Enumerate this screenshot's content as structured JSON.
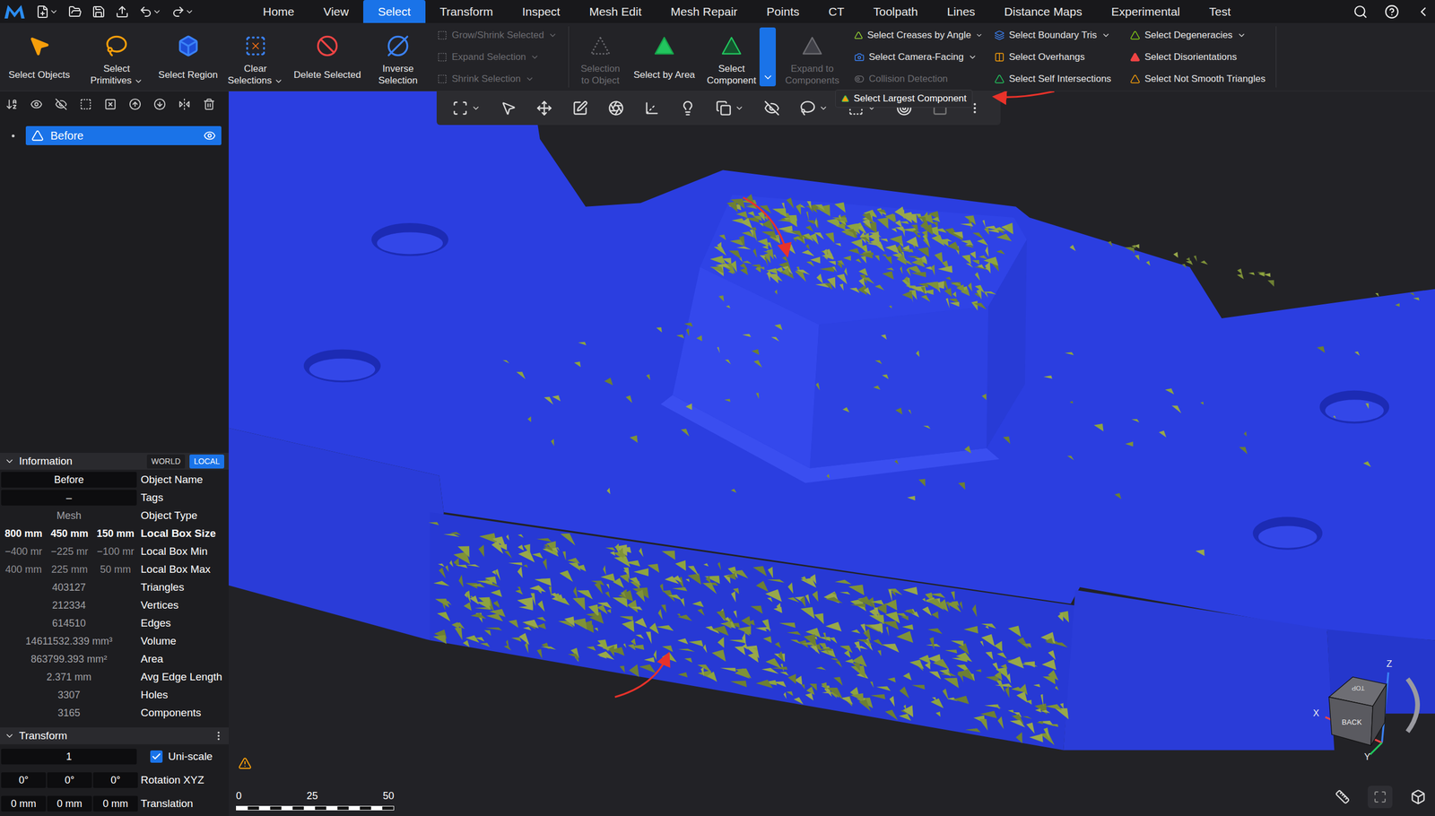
{
  "menubar": {
    "tabs": [
      {
        "label": "Home",
        "selected": false
      },
      {
        "label": "View",
        "selected": false
      },
      {
        "label": "Select",
        "selected": true
      },
      {
        "label": "Transform",
        "selected": false
      },
      {
        "label": "Inspect",
        "selected": false
      },
      {
        "label": "Mesh Edit",
        "selected": false
      },
      {
        "label": "Mesh Repair",
        "selected": false
      },
      {
        "label": "Points",
        "selected": false
      },
      {
        "label": "CT",
        "selected": false
      },
      {
        "label": "Toolpath",
        "selected": false
      },
      {
        "label": "Lines",
        "selected": false
      },
      {
        "label": "Distance Maps",
        "selected": false
      },
      {
        "label": "Experimental",
        "selected": false
      },
      {
        "label": "Test",
        "selected": false
      }
    ]
  },
  "ribbon": {
    "sections": [
      {
        "groups": [
          {
            "kind": "large",
            "label": "Select Objects",
            "disabled": false,
            "has_menu": false,
            "dropdown_open": false
          },
          {
            "kind": "large",
            "label": "Select Primitives",
            "disabled": false,
            "has_menu": true,
            "dropdown_open": false
          },
          {
            "kind": "large",
            "label": "Select Region",
            "disabled": false,
            "has_menu": false,
            "dropdown_open": false
          },
          {
            "kind": "large",
            "label": "Clear Selections",
            "disabled": false,
            "has_menu": true,
            "dropdown_open": false
          },
          {
            "kind": "large",
            "label": "Delete Selected",
            "disabled": false,
            "has_menu": false,
            "dropdown_open": false
          },
          {
            "kind": "large",
            "label": "Inverse Selection",
            "disabled": false,
            "has_menu": false,
            "dropdown_open": false
          },
          {
            "kind": "column",
            "items": [
              {
                "label": "Grow/Shrink Selected",
                "disabled": true,
                "has_menu": true
              },
              {
                "label": "Expand Selection",
                "disabled": true,
                "has_menu": true
              },
              {
                "label": "Shrink Selection",
                "disabled": true,
                "has_menu": true
              }
            ]
          }
        ]
      },
      {
        "groups": [
          {
            "kind": "large",
            "label": "Selection to Object",
            "disabled": true,
            "has_menu": false,
            "dropdown_open": false
          },
          {
            "kind": "large",
            "label": "Select by Area",
            "disabled": false,
            "has_menu": false,
            "dropdown_open": false
          },
          {
            "kind": "large",
            "label": "Select Component",
            "disabled": false,
            "has_menu": false,
            "dropdown_open": true
          },
          {
            "kind": "large",
            "label": "Expand to Components",
            "disabled": true,
            "has_menu": false,
            "dropdown_open": false
          },
          {
            "kind": "column",
            "items": [
              {
                "label": "Select Creases by Angle",
                "disabled": false,
                "has_menu": true
              },
              {
                "label": "Select Camera-Facing",
                "disabled": false,
                "has_menu": true
              },
              {
                "label": "Collision Detection",
                "disabled": true,
                "has_menu": false
              }
            ]
          },
          {
            "kind": "column",
            "items": [
              {
                "label": "Select Boundary Tris",
                "disabled": false,
                "has_menu": true
              },
              {
                "label": "Select Overhangs",
                "disabled": false,
                "has_menu": false
              },
              {
                "label": "Select Self Intersections",
                "disabled": false,
                "has_menu": false
              }
            ]
          },
          {
            "kind": "column",
            "items": [
              {
                "label": "Select Degeneracies",
                "disabled": false,
                "has_menu": true
              },
              {
                "label": "Select Disorientations",
                "disabled": false,
                "has_menu": false
              },
              {
                "label": "Select Not Smooth Triangles",
                "disabled": false,
                "has_menu": false
              }
            ]
          }
        ]
      }
    ]
  },
  "dropdown": {
    "items": [
      {
        "label": "Select Largest Component"
      }
    ]
  },
  "scene_tree": {
    "items": [
      {
        "label": "Before",
        "selected": true,
        "visible": true
      }
    ]
  },
  "information": {
    "title": "Information",
    "expanded": true,
    "frames": [
      {
        "label": "WORLD",
        "selected": false
      },
      {
        "label": "LOCAL",
        "selected": true
      }
    ],
    "rows": [
      {
        "kind": "field",
        "values": [
          "Before"
        ],
        "label": "Object Name"
      },
      {
        "kind": "field",
        "values": [
          "–"
        ],
        "label": "Tags"
      },
      {
        "kind": "plain",
        "values": [
          "Mesh"
        ],
        "label": "Object Type"
      },
      {
        "kind": "bold",
        "values": [
          "800 mm",
          "450 mm",
          "150 mm"
        ],
        "label": "Local Box Size"
      },
      {
        "kind": "dim",
        "values": [
          "−400 mr",
          "−225 mr",
          "−100 mr"
        ],
        "label": "Local Box Min"
      },
      {
        "kind": "dim",
        "values": [
          "400 mm",
          "225 mm",
          "50 mm"
        ],
        "label": "Local Box Max"
      },
      {
        "kind": "plain",
        "values": [
          "403127"
        ],
        "label": "Triangles"
      },
      {
        "kind": "plain",
        "values": [
          "212334"
        ],
        "label": "Vertices"
      },
      {
        "kind": "plain",
        "values": [
          "614510"
        ],
        "label": "Edges"
      },
      {
        "kind": "plain",
        "values": [
          "14611532.339 mm³"
        ],
        "label": "Volume"
      },
      {
        "kind": "plain",
        "values": [
          "863799.393 mm²"
        ],
        "label": "Area"
      },
      {
        "kind": "plain",
        "values": [
          "2.371 mm"
        ],
        "label": "Avg Edge Length"
      },
      {
        "kind": "plain",
        "values": [
          "3307"
        ],
        "label": "Holes"
      },
      {
        "kind": "plain",
        "values": [
          "3165"
        ],
        "label": "Components"
      }
    ]
  },
  "transform": {
    "title": "Transform",
    "expanded": true,
    "rows": [
      {
        "kind": "checkbox",
        "values": [
          "1"
        ],
        "label": "Uni-scale",
        "checked": true
      },
      {
        "kind": "field",
        "values": [
          "0°",
          "0°",
          "0°"
        ],
        "label": "Rotation XYZ"
      },
      {
        "kind": "field",
        "values": [
          "0 mm",
          "0 mm",
          "0 mm"
        ],
        "label": "Translation"
      }
    ]
  },
  "viewport": {
    "scale_bar": {
      "ticks": [
        "0",
        "25",
        "50"
      ]
    },
    "view_cube": {
      "faces": [
        "TOP",
        "BACK"
      ],
      "axes": [
        "X",
        "Y",
        "Z"
      ]
    }
  }
}
